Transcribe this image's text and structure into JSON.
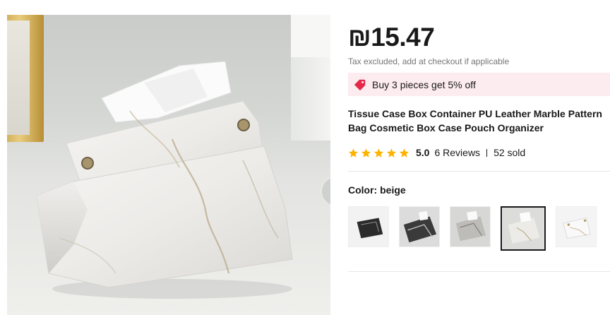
{
  "product_image": {
    "alt": "tissue-box-photo"
  },
  "product": {
    "price": "₪15.47",
    "tax_note": "Tax excluded, add at checkout if applicable",
    "promo": "Buy 3 pieces get 5% off",
    "title_line1": "Tissue Case Box Container PU Leather Marble Pattern",
    "title_line2": "Bag Cosmetic Box Case Pouch Organizer",
    "rating": "5.0",
    "stars": 5,
    "reviews": "6 Reviews",
    "sold": "52 sold",
    "color_label": "Color: beige"
  },
  "swatches": [
    {
      "name": "black-marble-dark",
      "selected": false
    },
    {
      "name": "black-marble",
      "selected": false
    },
    {
      "name": "grey-marble",
      "selected": false
    },
    {
      "name": "beige",
      "selected": true
    },
    {
      "name": "white",
      "selected": false
    }
  ],
  "colors": {
    "promo_bg": "#fdecef",
    "promo_icon": "#e5294a",
    "star": "#fdb300",
    "text": "#191919",
    "muted": "#757575"
  }
}
